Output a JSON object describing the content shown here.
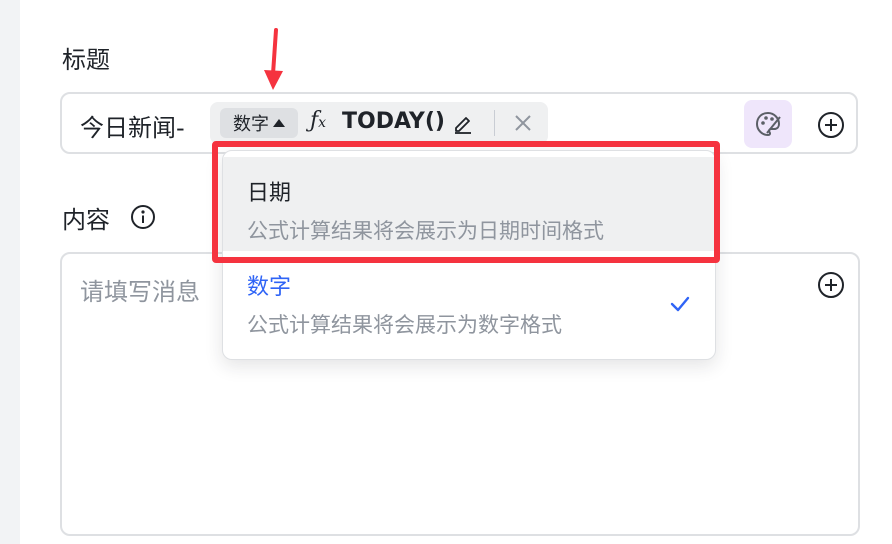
{
  "form": {
    "title_label": "标题",
    "title_prefix": "今日新闻-",
    "formula_chip": {
      "type_tag": "数字",
      "formula": "TODAY()"
    },
    "content_label": "内容",
    "content_placeholder": "请填写消息"
  },
  "dropdown": {
    "options": [
      {
        "title": "日期",
        "description": "公式计算结果将会展示为日期时间格式",
        "selected": false,
        "highlighted": true
      },
      {
        "title": "数字",
        "description": "公式计算结果将会展示为数字格式",
        "selected": true
      }
    ]
  },
  "colors": {
    "accent_blue": "#2f64f6",
    "highlight_red": "#f5333f",
    "style_button_bg": "#efe6fb"
  },
  "icons": [
    "info-icon",
    "fx-icon",
    "edit-icon",
    "close-icon",
    "palette-icon",
    "add-circle-icon",
    "checkmark-icon",
    "arrow-down-annotation"
  ]
}
